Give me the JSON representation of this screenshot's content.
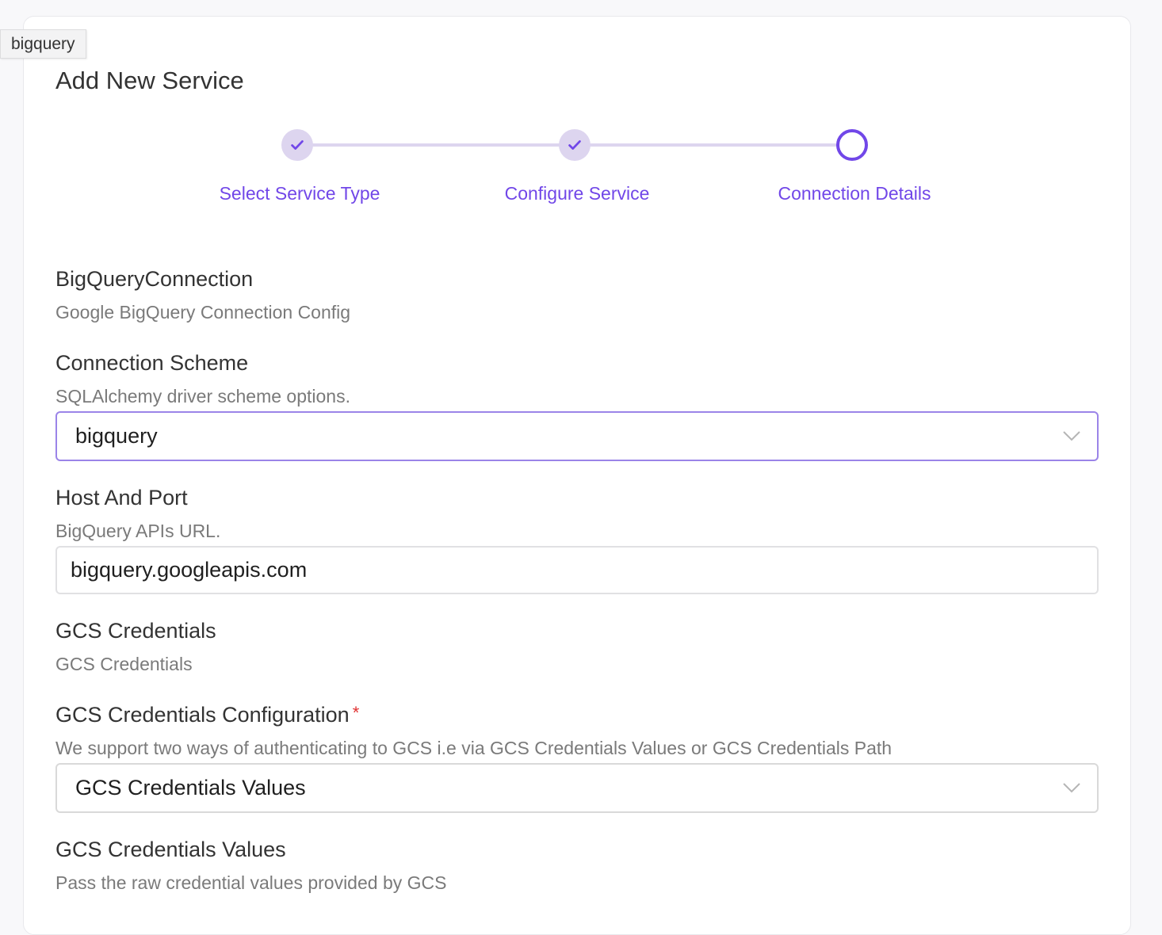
{
  "tooltip": "bigquery",
  "page_title": "Add New Service",
  "stepper": {
    "steps": [
      {
        "label": "Select Service Type",
        "status": "completed"
      },
      {
        "label": "Configure Service",
        "status": "completed"
      },
      {
        "label": "Connection Details",
        "status": "active"
      }
    ],
    "accent_color": "#7147e8",
    "track_color": "#ddd5ef"
  },
  "connection": {
    "title": "BigQueryConnection",
    "description": "Google BigQuery Connection Config"
  },
  "connection_scheme": {
    "label": "Connection Scheme",
    "description": "SQLAlchemy driver scheme options.",
    "value": "bigquery",
    "icon": "chevron-down-icon"
  },
  "host_port": {
    "label": "Host And Port",
    "description": "BigQuery APIs URL.",
    "value": "bigquery.googleapis.com"
  },
  "gcs_credentials": {
    "title": "GCS Credentials",
    "description": "GCS Credentials"
  },
  "gcs_config": {
    "label": "GCS Credentials Configuration",
    "required_mark": "*",
    "description": "We support two ways of authenticating to GCS i.e via GCS Credentials Values or GCS Credentials Path",
    "value": "GCS Credentials Values",
    "icon": "chevron-down-icon"
  },
  "gcs_values": {
    "title": "GCS Credentials Values",
    "description": "Pass the raw credential values provided by GCS"
  }
}
